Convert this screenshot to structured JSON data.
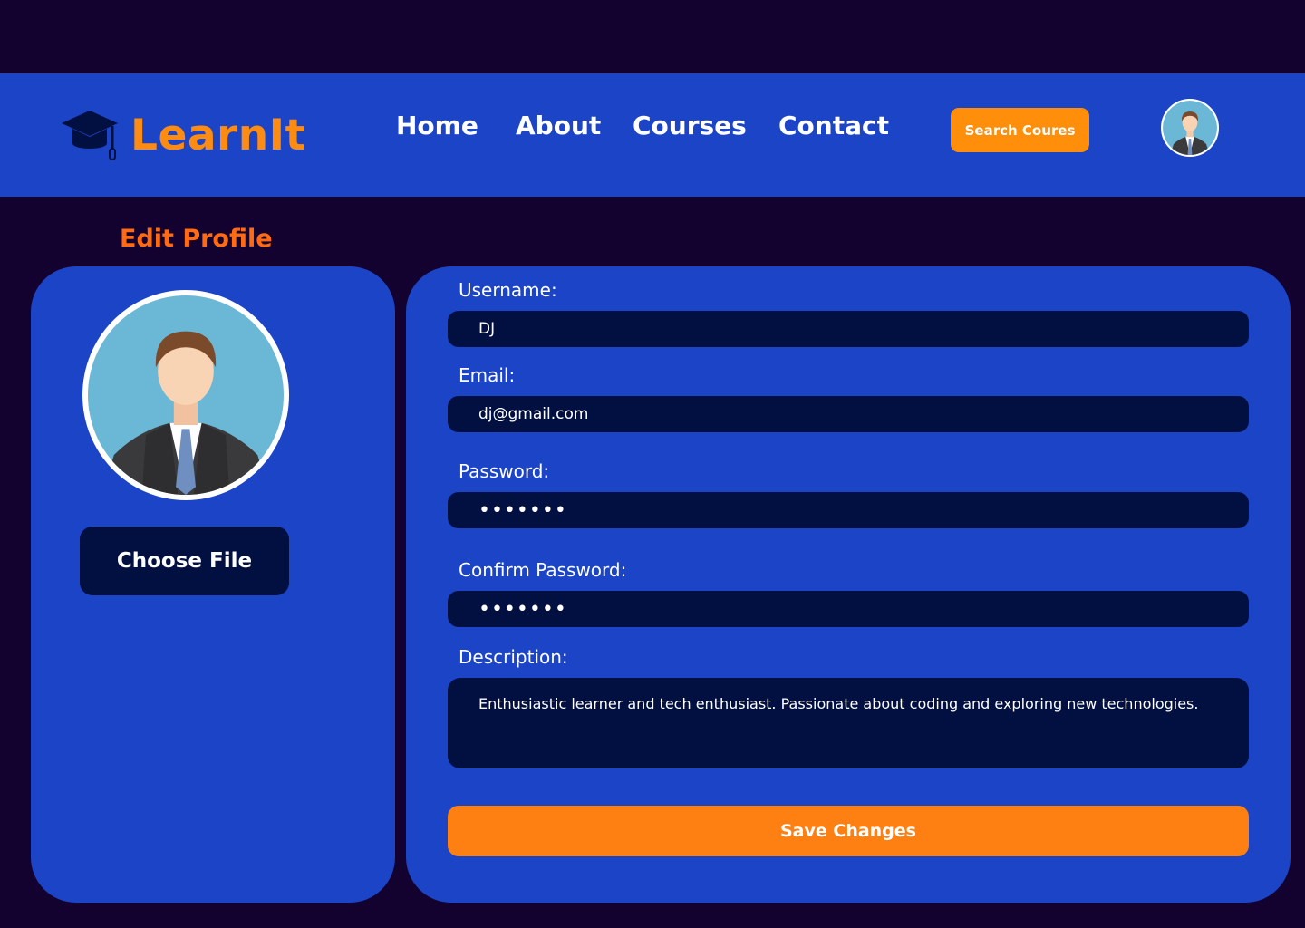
{
  "brand": {
    "name": "LearnIt",
    "color": "#ff8c12"
  },
  "nav": {
    "links": [
      "Home",
      "About",
      "Courses",
      "Contact"
    ],
    "search_label": "Search Coures"
  },
  "page": {
    "title": "Edit Profile"
  },
  "profile": {
    "choose_file_label": "Choose File"
  },
  "form": {
    "username_label": "Username:",
    "username_value": "DJ",
    "email_label": "Email:",
    "email_value": "dj@gmail.com",
    "password_label": "Password:",
    "password_value": "•••••••",
    "confirm_label": "Confirm Password:",
    "confirm_value": "•••••••",
    "description_label": "Description:",
    "description_value": "Enthusiastic learner and tech enthusiast. Passionate about coding and exploring new technologies.",
    "save_label": "Save Changes"
  },
  "colors": {
    "background": "#13022f",
    "panel": "#1c44c6",
    "input": "#010f41",
    "accent": "#ff8012"
  },
  "icons": {
    "logo": "graduation-cap-icon",
    "avatar": "user-avatar-icon"
  }
}
